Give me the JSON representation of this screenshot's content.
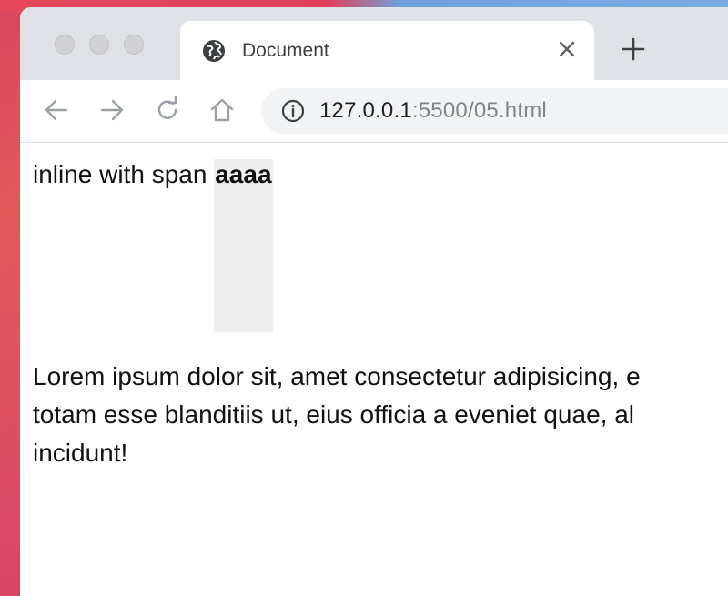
{
  "browser": {
    "tab_title": "Document",
    "url_host": "127.0.0.1",
    "url_rest": ":5500/05.html",
    "icons": {
      "favicon": "globe-icon",
      "close": "close-icon",
      "new_tab": "plus-icon",
      "back": "arrow-left-icon",
      "forward": "arrow-right-icon",
      "reload": "reload-icon",
      "home": "home-icon",
      "site_info": "info-icon"
    }
  },
  "content": {
    "inline_text": "inline with span ",
    "span_text": "aaaa",
    "lorem_lines": [
      "Lorem ipsum dolor sit, amet consectetur adipisicing, e",
      "totam esse blanditiis ut, eius officia a eveniet quae, al",
      "incidunt!"
    ]
  },
  "colors": {
    "tabstrip": "#dee1e6",
    "omnibox": "#f1f3f4",
    "span_bg": "#eeeeee"
  }
}
